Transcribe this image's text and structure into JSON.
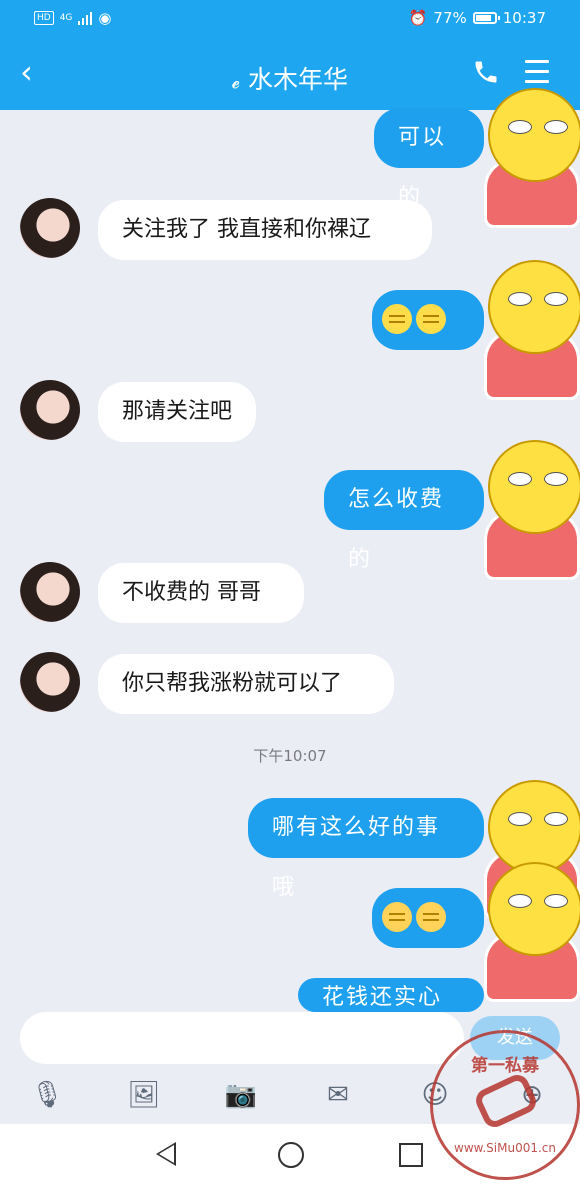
{
  "status": {
    "time": "10:37",
    "battery": "77%",
    "network": "4G"
  },
  "header": {
    "title": "水木年华"
  },
  "messages": [
    {
      "side": "out",
      "text": "可以的"
    },
    {
      "side": "in",
      "text": "关注我了 我直接和你裸辽"
    },
    {
      "side": "out",
      "text": ""
    },
    {
      "side": "in",
      "text": "那请关注吧"
    },
    {
      "side": "out",
      "text": "怎么收费的"
    },
    {
      "side": "in",
      "text": "不收费的 哥哥"
    },
    {
      "side": "in",
      "text": "你只帮我涨粉就可以了"
    },
    {
      "side": "out",
      "text": "哪有这么好的事哦"
    },
    {
      "side": "out",
      "text": ""
    },
    {
      "side": "out",
      "text": "花钱还实心点"
    }
  ],
  "timestamp": "下午10:07",
  "input": {
    "placeholder": "",
    "send_label": "发送"
  },
  "toolbar": [
    "microphone-icon",
    "image-icon",
    "camera-icon",
    "red-packet-icon",
    "emoji-icon",
    "plus-icon"
  ],
  "watermark": {
    "top": "第一私募",
    "url": "www.SiMu001.cn"
  },
  "colors": {
    "accent": "#1fa6f0",
    "bubble_out": "#1ea0ee",
    "background": "#ebedf5"
  }
}
